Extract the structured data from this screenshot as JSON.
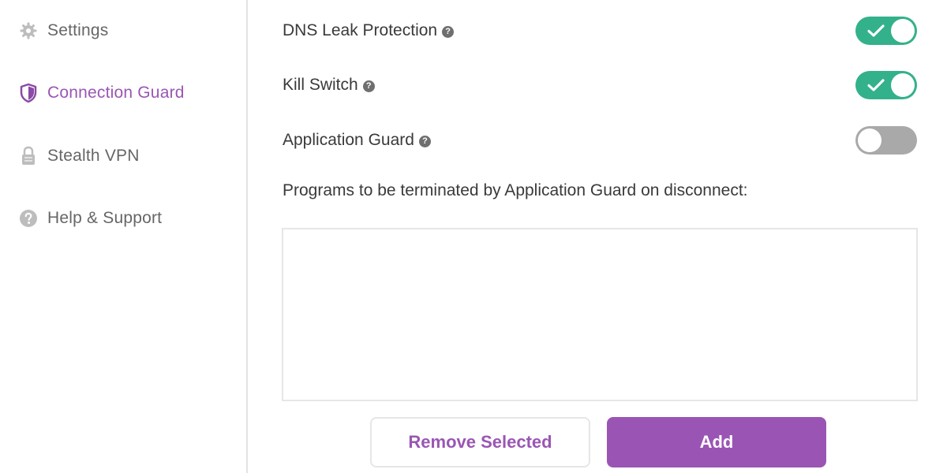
{
  "sidebar": {
    "items": [
      {
        "label": "Settings",
        "icon": "gear-icon",
        "active": false
      },
      {
        "label": "Connection Guard",
        "icon": "shield-icon",
        "active": true
      },
      {
        "label": "Stealth VPN",
        "icon": "lock-icon",
        "active": false
      },
      {
        "label": "Help & Support",
        "icon": "help-icon",
        "active": false
      }
    ]
  },
  "main": {
    "settings": [
      {
        "label": "DNS Leak Protection",
        "enabled": true
      },
      {
        "label": "Kill Switch",
        "enabled": true
      },
      {
        "label": "Application Guard",
        "enabled": false
      }
    ],
    "help_glyph": "?",
    "programs_label": "Programs to be terminated by Application Guard on disconnect:",
    "programs": [],
    "buttons": {
      "remove_label": "Remove Selected",
      "add_label": "Add"
    }
  },
  "colors": {
    "accent": "#9a56b4",
    "toggle_on": "#33b18a",
    "toggle_off": "#a9a9a9"
  }
}
